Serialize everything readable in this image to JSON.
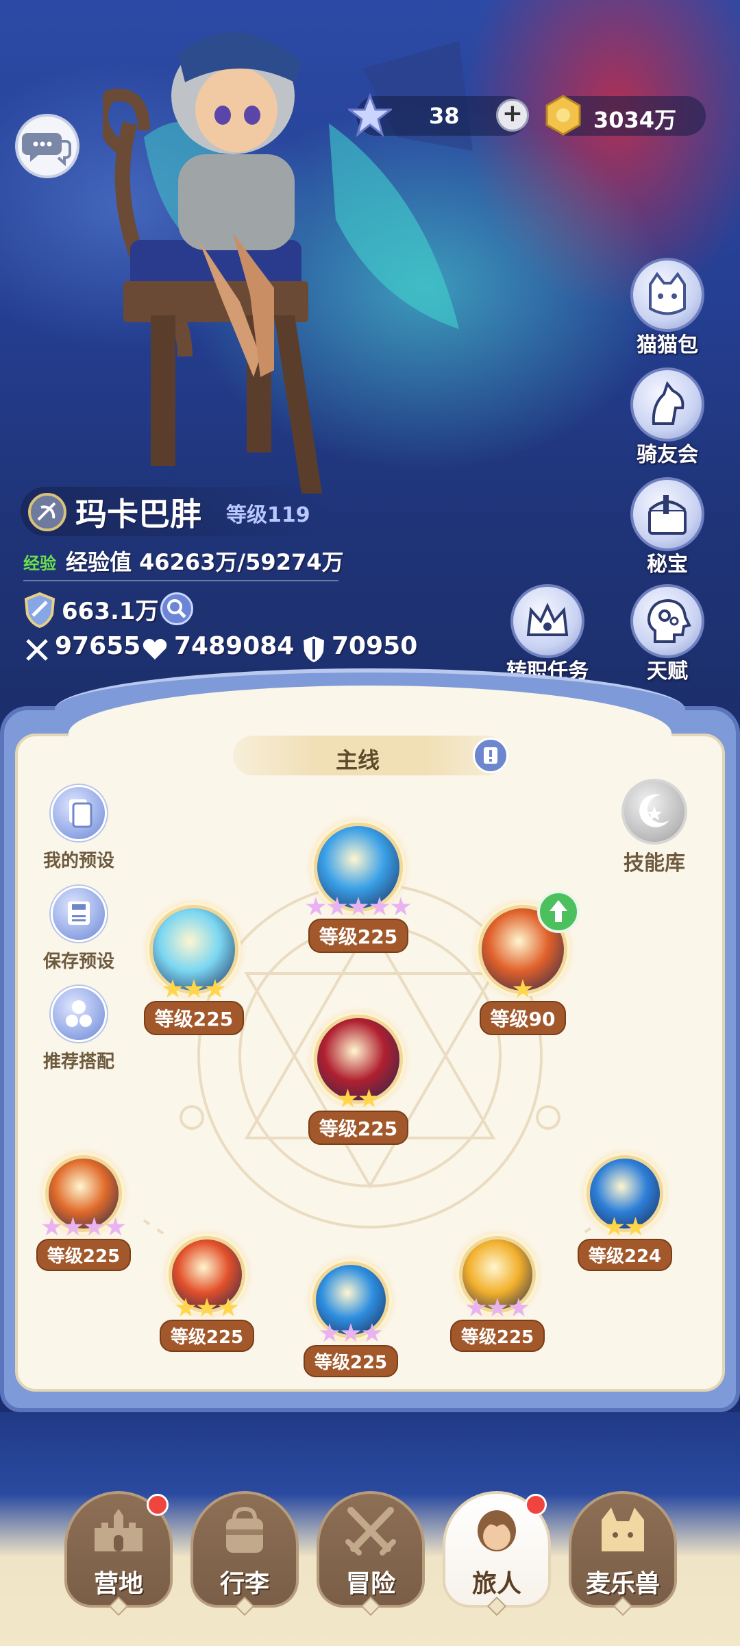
{
  "resources": {
    "stars": "38",
    "coins": "3034万",
    "star_icon": "star-crystal-icon",
    "coin_icon": "gold-coin-icon"
  },
  "side_buttons": [
    {
      "label": "猫猫包",
      "icon": "cat-bag-icon"
    },
    {
      "label": "骑友会",
      "icon": "horse-head-icon"
    },
    {
      "label": "秘宝",
      "icon": "treasure-chest-icon"
    },
    {
      "label": "转职任务",
      "icon": "crown-icon"
    },
    {
      "label": "天赋",
      "icon": "head-gears-icon"
    }
  ],
  "player": {
    "name": "玛卡巴肨",
    "level": "等级119",
    "exp_tag": "经验",
    "exp_text": "经验值 46263万/59274万",
    "power": "663.1万",
    "attack": "97655",
    "hp": "7489084",
    "defense": "70950"
  },
  "skill_panel": {
    "tab": "主线",
    "left_buttons": [
      {
        "label": "我的预设",
        "icon": "preset-cards-icon"
      },
      {
        "label": "保存预设",
        "icon": "save-disk-icon"
      },
      {
        "label": "推荐搭配",
        "icon": "recommend-gears-icon"
      }
    ],
    "library": "技能库",
    "skills": [
      {
        "level": "等级225",
        "stars": 5,
        "star_type": "pink",
        "color": "#3aa0e8"
      },
      {
        "level": "等级225",
        "stars": 3,
        "star_type": "gold",
        "color": "#7ad6f2"
      },
      {
        "level": "等级90",
        "stars": 1,
        "star_type": "gold",
        "color": "#e0602a"
      },
      {
        "level": "等级225",
        "stars": 2,
        "star_type": "gold",
        "color": "#b02030"
      },
      {
        "level": "等级225",
        "stars": 4,
        "star_type": "pink",
        "color": "#e06a2a"
      },
      {
        "level": "等级224",
        "stars": 2,
        "star_type": "gold",
        "color": "#2d7fd8"
      },
      {
        "level": "等级225",
        "stars": 3,
        "star_type": "gold",
        "color": "#e2502a"
      },
      {
        "level": "等级225",
        "stars": 3,
        "star_type": "pink",
        "color": "#2e8fe0"
      },
      {
        "level": "等级225",
        "stars": 3,
        "star_type": "pink",
        "color": "#f2b02c"
      }
    ]
  },
  "nav": [
    {
      "label": "营地",
      "badge": true,
      "active": false
    },
    {
      "label": "行李",
      "badge": false,
      "active": false
    },
    {
      "label": "冒险",
      "badge": false,
      "active": false
    },
    {
      "label": "旅人",
      "badge": true,
      "active": true
    },
    {
      "label": "麦乐兽",
      "badge": false,
      "active": false
    }
  ]
}
